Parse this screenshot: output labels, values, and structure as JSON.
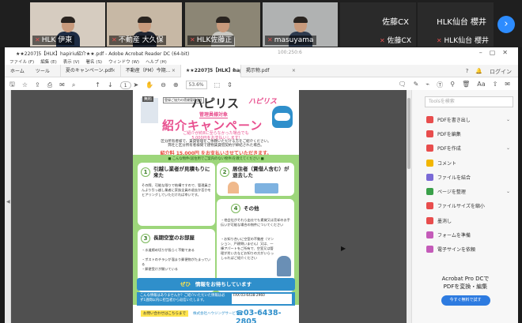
{
  "video_strip": {
    "participants": [
      {
        "name": "HLK 伊東",
        "bg": "#d6ccc0",
        "shirt": "#1e2c44"
      },
      {
        "name": "不動産 大久保",
        "bg": "#c7b8a5",
        "shirt": "#202633"
      },
      {
        "name": "HLK佐藤正",
        "bg": "#8c8675",
        "shirt": "#c9c8c2"
      },
      {
        "name": "masuyama",
        "bg": "#b0b2b2",
        "shirt": "#2d3a4e"
      }
    ],
    "blank_tiles": [
      {
        "name": "佐藤CX",
        "sub": "佐藤CX"
      },
      {
        "name": "HLK仙台 櫻井",
        "sub": "HLK仙台 櫻井"
      }
    ],
    "next_icon": "›"
  },
  "acrobat": {
    "title": "★★2207]5【HLK】hapiriu紹介★★.pdf - Adobe Acrobat Reader DC (64-bit)",
    "center_text": "100:250:6",
    "menu": [
      "ファイル (F)",
      "編集 (E)",
      "表示 (V)",
      "署名 (S)",
      "ウィンドウ (W)",
      "ヘルプ (H)"
    ],
    "nav": [
      "ホーム",
      "ツール"
    ],
    "tabs": [
      {
        "label": "夏のキャンペーン.pdf",
        "active": false
      },
      {
        "label": "不動産（PM）今期…",
        "active": false
      },
      {
        "label": "★★2207]5【HLK】hapi…",
        "active": true
      },
      {
        "label": "掲示物.pdf",
        "active": false
      }
    ],
    "tab_right_icons": [
      "?",
      "🔔",
      "ログイン"
    ],
    "toolbar": {
      "page_current": "1",
      "page_total": "/ 2",
      "zoom": "53.6%"
    },
    "right_panel": {
      "search_placeholder": "Toolsを検索",
      "items": [
        {
          "label": "PDFを書き出し",
          "color": "#e84d4d",
          "chev": true
        },
        {
          "label": "PDFを編集",
          "color": "#e84d4d",
          "chev": false
        },
        {
          "label": "PDFを作成",
          "color": "#e84d4d",
          "chev": true
        },
        {
          "label": "コメント",
          "color": "#f2b600",
          "chev": false
        },
        {
          "label": "ファイルを結合",
          "color": "#7a6ad6",
          "chev": false
        },
        {
          "label": "ページを整理",
          "color": "#3aa04a",
          "chev": true
        },
        {
          "label": "ファイルサイズを縮小",
          "color": "#e84d4d",
          "chev": false
        },
        {
          "label": "墨消し",
          "color": "#e84d4d",
          "chev": false
        },
        {
          "label": "フォームを準備",
          "color": "#c45bb9",
          "chev": false
        },
        {
          "label": "電子サインを依頼",
          "color": "#c45bb9",
          "chev": false
        }
      ],
      "promo_line1": "Acrobat Pro DCで",
      "promo_line2": "PDFを変換・編集",
      "promo_button": "今すぐ無料で試す"
    },
    "left_gutter_arrow": "◀",
    "right_gutter_arrow": "◀"
  },
  "flyer": {
    "tag": "無料",
    "tag2": "登録ご協力の賃貸管理会社",
    "title": "ハピリス",
    "logo": "ハピリス",
    "subtitle": "管理員様対象",
    "campaign": "紹介キャンペーン",
    "lead1": "ご紹介が約8に至らなかった場合でも",
    "lead2": "5,000円をお支払いします!",
    "body1": "区分所有者様で、賃貸管理をご依頼いただける方をご紹介ください。",
    "body2": "弊社と区分所有者様間で建物賃貸借契約が締結された場合。",
    "fee": "紹介料 15,000円 をお支払いさせていただきます。",
    "band": "■ こんな物件(居住用でご案内のない物件)を教えてください ■",
    "box1_num": "1",
    "box1_title": "引越し業者が見積もりに来た",
    "box1_text": "その際、可能な限りで結構ですので、管理員さんより引っ越し業者に家族全員の退去か否かをヒアリングしていただければ幸いです。",
    "box2_num": "2",
    "box2_title": "居住者（賃借人含む）が退去した",
    "box3_num": "3",
    "box3_title": "長期空室のお部屋",
    "box3_items": [
      "・水道締め切りが長らく不動である",
      "・ポストのチラシが溜まり郵便物がたまっている",
      "・郵便受けが開いている"
    ],
    "box4_num": "4",
    "box4_title": "その他",
    "box4_items": [
      "・他会社がそれら出仕でも賃貸又は売却のお手伝いが可能な場合の物件についてください",
      "・お知り合いに空室の不動産（マンション、戸建問いません）又は、一棟アパートをご所有で、空室又は管理が劣い方などお知りの方がいらっしゃればご紹介ください"
    ],
    "banner_em": "ぜひ",
    "banner": "情報をお待ちしています",
    "foot_text": "こんな情報はありませんか？ご紹介いただいた情報は必ず1週間以内に担当者から返信いたします。",
    "fax": "FAX:03-6438-2960",
    "ask": "お問い合わせはこちらまで",
    "company": "株式会社ハウジングサービス",
    "tel": "03-6438-2805"
  }
}
